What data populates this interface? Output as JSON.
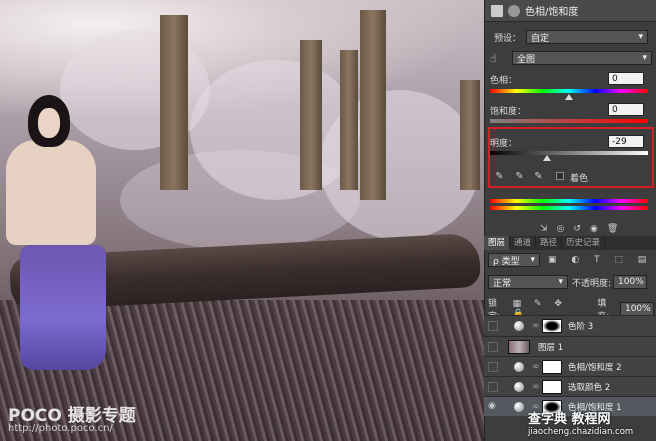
{
  "canvas": {
    "watermark": "POCO 摄影专题",
    "watermark_url": "http://photo.poco.cn/"
  },
  "panel": {
    "title": "色相/饱和度",
    "preset_label": "预设：",
    "preset_value": "自定",
    "channel_value": "全图",
    "hue_label": "色相：",
    "hue_value": "0",
    "saturation_label": "饱和度：",
    "saturation_value": "0",
    "lightness_label": "明度：",
    "lightness_value": "-29",
    "colorize_label": "着色",
    "lightness_level_fraction": 0.355
  },
  "layers_panel": {
    "tabs": [
      "图层",
      "通道",
      "路径",
      "历史记录"
    ],
    "kind_label": "ρ 类型",
    "blend_mode": "正常",
    "opacity_label": "不透明度:",
    "opacity_value": "100%",
    "lock_label": "锁定:",
    "fill_label": "填充:",
    "fill_value": "100%",
    "layers": [
      {
        "name": "色阶 3",
        "visible": false,
        "type": "adjustment-dark-mask",
        "selected": false
      },
      {
        "name": "图层 1",
        "visible": false,
        "type": "photo",
        "selected": false
      },
      {
        "name": "色相/饱和度 2",
        "visible": false,
        "type": "adjustment",
        "selected": false
      },
      {
        "name": "选取颜色 2",
        "visible": false,
        "type": "adjustment",
        "selected": false
      },
      {
        "name": "色相/饱和度 1",
        "visible": true,
        "type": "adjustment-dark-mask",
        "selected": true
      }
    ]
  },
  "overlay_watermark": {
    "text": "查字典 教程网",
    "url": "jiaocheng.chazidian.com"
  },
  "colors": {
    "highlight_border": "#d61f26",
    "panel_bg": "#3d3d3d"
  }
}
